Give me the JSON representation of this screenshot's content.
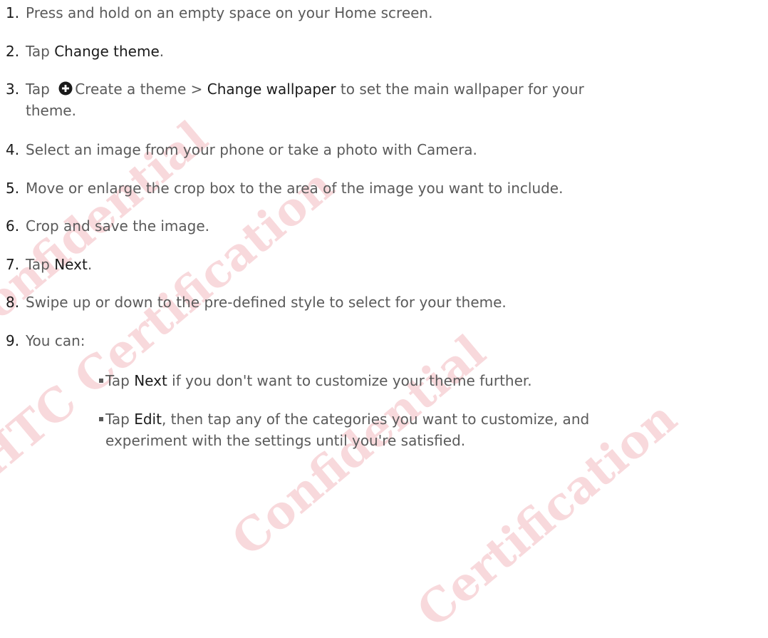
{
  "watermark": {
    "lines": [
      "Confidential",
      "HTC Certification",
      "Confidential",
      "Certification"
    ]
  },
  "steps": [
    {
      "number": "1.",
      "text": "Press and hold on an empty space on your Home screen."
    },
    {
      "number": "2.",
      "prefix": "Tap ",
      "strong": "Change theme",
      "suffix": "."
    },
    {
      "number": "3.",
      "prefix": "Tap ",
      "icon": "plus-circle-icon",
      "mid": "Create a theme > ",
      "strong": "Change wallpaper",
      "suffix": " to set the main wallpaper for your",
      "continuation": "theme."
    },
    {
      "number": "4.",
      "text": "Select an image from your phone or take a photo with Camera."
    },
    {
      "number": "5.",
      "text": "Move or enlarge the crop box to the area of the image you want to include."
    },
    {
      "number": "6.",
      "text": "Crop and save the image."
    },
    {
      "number": "7.",
      "prefix": "Tap ",
      "strong": "Next",
      "suffix": "."
    },
    {
      "number": "8.",
      "text": "Swipe up or down to the pre-defined style to select for your theme."
    },
    {
      "number": "9.",
      "text": "You can:"
    }
  ],
  "bullets": [
    {
      "prefix": "Tap ",
      "strong": "Next",
      "suffix": " if you don't want to customize your theme further."
    },
    {
      "prefix": "Tap ",
      "strong": "Edit",
      "suffix": ", then tap any of the categories you want to customize, and",
      "continuation": "experiment with the settings until you're satisfied."
    }
  ],
  "colors": {
    "text": "#5a5a5a",
    "emphasis": "#1a1a1a",
    "watermark": "#d61e32"
  }
}
